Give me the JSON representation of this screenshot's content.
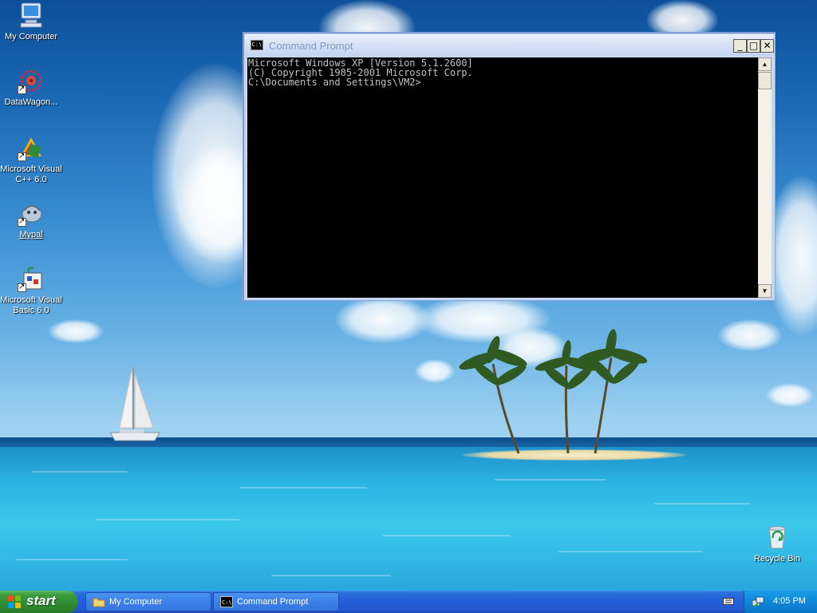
{
  "desktop": {
    "icons": [
      {
        "label": "My Computer",
        "icon": "my-computer-icon"
      },
      {
        "label": "DataWagon...",
        "icon": "datawagon-icon"
      },
      {
        "label": "Microsoft Visual C++ 6.0",
        "icon": "visual-cpp-icon"
      },
      {
        "label": "Mypal",
        "icon": "mypal-icon"
      },
      {
        "label": "Microsoft Visual Basic 6.0",
        "icon": "visual-basic-icon"
      },
      {
        "label": "Recycle Bin",
        "icon": "recycle-bin-icon"
      }
    ]
  },
  "window": {
    "title": "Command Prompt",
    "icon_text": "C:\\",
    "controls": {
      "minimize": "_",
      "maximize": "□",
      "close": "✕"
    },
    "console_lines": [
      "Microsoft Windows XP [Version 5.1.2600]",
      "(C) Copyright 1985-2001 Microsoft Corp.",
      "",
      "C:\\Documents and Settings\\VM2>"
    ],
    "scroll_up": "▲",
    "scroll_down": "▼"
  },
  "taskbar": {
    "start_label": "start",
    "tasks": [
      {
        "label": "My Computer",
        "icon": "folder-icon"
      },
      {
        "label": "Command Prompt",
        "icon": "cmd-icon"
      }
    ],
    "clock": "4:05 PM"
  },
  "colors": {
    "console_bg": "#000000",
    "console_text": "#c0c0c0",
    "taskbar_blue": "#245edb",
    "start_green": "#3d9b3d",
    "tray_blue": "#0e87d9"
  }
}
